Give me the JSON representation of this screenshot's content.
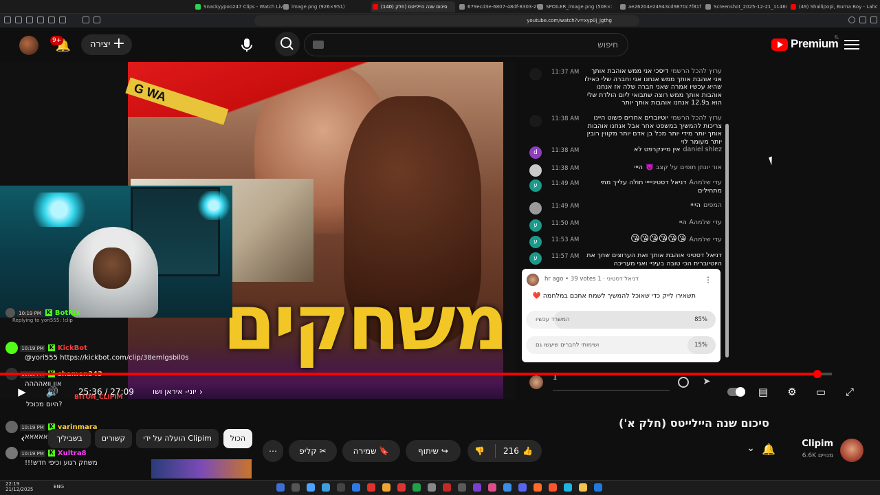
{
  "browser": {
    "tabs": [
      {
        "label": "Snackyypoo247 Clips - Watch Live o",
        "color": "#2bd34f"
      },
      {
        "label": "image.png (926×951)",
        "color": "#888888"
      },
      {
        "label": "סיכום שנה היילייטס (חלק (140)",
        "color": "#ff0000"
      },
      {
        "label": "679ecd3e-6807-48df-8303-2fedd9e",
        "color": "#888888"
      },
      {
        "label": "SPOILER_image.png (508×372)",
        "color": "#888888"
      },
      {
        "label": "ae26204e24943cd9870c7f81f6557f6",
        "color": "#888888"
      },
      {
        "label": "Screenshot_2025-12-21_114606.png",
        "color": "#888888"
      },
      {
        "label": "(49) Shallipopi, Burna Boy - Laho II (",
        "color": "#ff0000"
      }
    ],
    "url": "youtube.com/watch?v=xyp0j_jgthg"
  },
  "header": {
    "notif_count": "9+",
    "create_label": "יצירה",
    "search_placeholder": "חיפוש",
    "logo_text": "Premium",
    "country": "IL"
  },
  "stream_chat": [
    {
      "time": "10:19 PM",
      "user": "BotRix",
      "user_color": "#53fc18",
      "text": "",
      "reply": "Replying to yori555: !clip"
    },
    {
      "time": "10:19 PM",
      "user": "KickBot",
      "user_color": "#ff3b3b",
      "text": "@yori555 https://kickbot.com/clip/38emlgsbil0s"
    },
    {
      "time": "10:19 PM",
      "user": "shamen343",
      "user_color": "#ffd23b",
      "text": "אוו וואהההה"
    },
    {
      "time": "10:19 PM",
      "user": "BITON_CLIPIM",
      "user_color": "#ff3b3b",
      "text": "היום מכוכל?"
    },
    {
      "time": "10:19 PM",
      "user": "yarinmara",
      "user_color": "#ffd23b",
      "text": "אאאאאא"
    },
    {
      "time": "10:19 PM",
      "user": "Xultra8",
      "user_color": "#ff3bff",
      "text": "משחק רגוע וכיפי חדש!!!"
    }
  ],
  "live_chat": [
    {
      "time": "11:37 AM",
      "author": "ערוץ להכל הרשמי",
      "text": "דיסכי אני ממש אוהבת אותך אני אוהבת אותך ממש אנחנו אני וחברה שלי כאילו שהיא עכשיו אמרה שאני חברה שלה אז אנחנו אוהבות אותך ממש רוצה שתבואי ליום הולדת שלי הוא ב12.9 אנחנו אוהבות אותך יותר",
      "avatar": "#1a1a1a"
    },
    {
      "time": "11:38 AM",
      "author": "ערוץ להכל הרשמי",
      "text": "יוטיוברים אחרים פשוט היינו צריכות להמשיך במשפט אחר אבל אנחנו אוהבות אותך יותר מידי יותר מכל בן אדם יותר מקווין רובין יותר מעומר לוי",
      "avatar": "#1a1a1a"
    },
    {
      "time": "11:38 AM",
      "author": "daniel shlez",
      "text": "אין מיינקרפט לא",
      "avatar": "#8e3fbf"
    },
    {
      "time": "11:38 AM",
      "author": "אור יונתן תופים על קצב 👿",
      "text": "הייי",
      "avatar": "#c9c9c9"
    },
    {
      "time": "11:49 AM",
      "author": "עדי שלמהA",
      "text": "דניאל דסטינייייי חולה עלייך מתי מתחילים",
      "avatar": "#1b9a8a"
    },
    {
      "time": "11:49 AM",
      "author": "המפים",
      "text": "היייי",
      "avatar": "#9a9a9a"
    },
    {
      "time": "11:50 AM",
      "author": "עדי שלמהA",
      "text": "היי",
      "avatar": "#1b9a8a"
    },
    {
      "time": "11:53 AM",
      "author": "עדי שלמהA",
      "text": "😘😘😘😘😘😘",
      "avatar": "#1b9a8a"
    },
    {
      "time": "11:57 AM",
      "author": "",
      "text": "דניאל דסטיני אוהבת אותך ואת הערוצים שחך את היוטיוברית הכי טובה בעיניי ואני מעריכה",
      "avatar": "#1b9a8a"
    }
  ],
  "poll": {
    "author": "דניאל דסטיני",
    "meta": "1 hr ago • 39 votes",
    "question": "תשאירו לייק כדי שאוכל להמשיך לשמח אתכם במלחמה ❤️",
    "options": [
      {
        "text": "המשרד עכשיו",
        "percent": "85%",
        "value": 0.85
      },
      {
        "text": "ושימותי לחברים שיעשו גם",
        "percent": "15%",
        "value": 0.15
      }
    ]
  },
  "chat_input": {
    "value": "1"
  },
  "player": {
    "time": "25:36 / 27:09",
    "chapter": "יוני- איראן ושו",
    "progress": 0.983
  },
  "video": {
    "overlay_title": "משחקים",
    "tape_text": "G WA",
    "title": "סיכום שנה היילייטס (חלק א')",
    "channel": "Clipim",
    "subscribers": "6.6K מנויים",
    "likes": "216",
    "share_label": "שיתוף",
    "save_label": "שמירה",
    "clip_label": "קליפ"
  },
  "filter_chips": [
    "הכול",
    "הועלה על ידי Clipim",
    "קשורים",
    "בשביליך"
  ],
  "taskbar": {
    "lang": "ENG",
    "clock_time": "22:19",
    "clock_date": "21/12/2025"
  }
}
